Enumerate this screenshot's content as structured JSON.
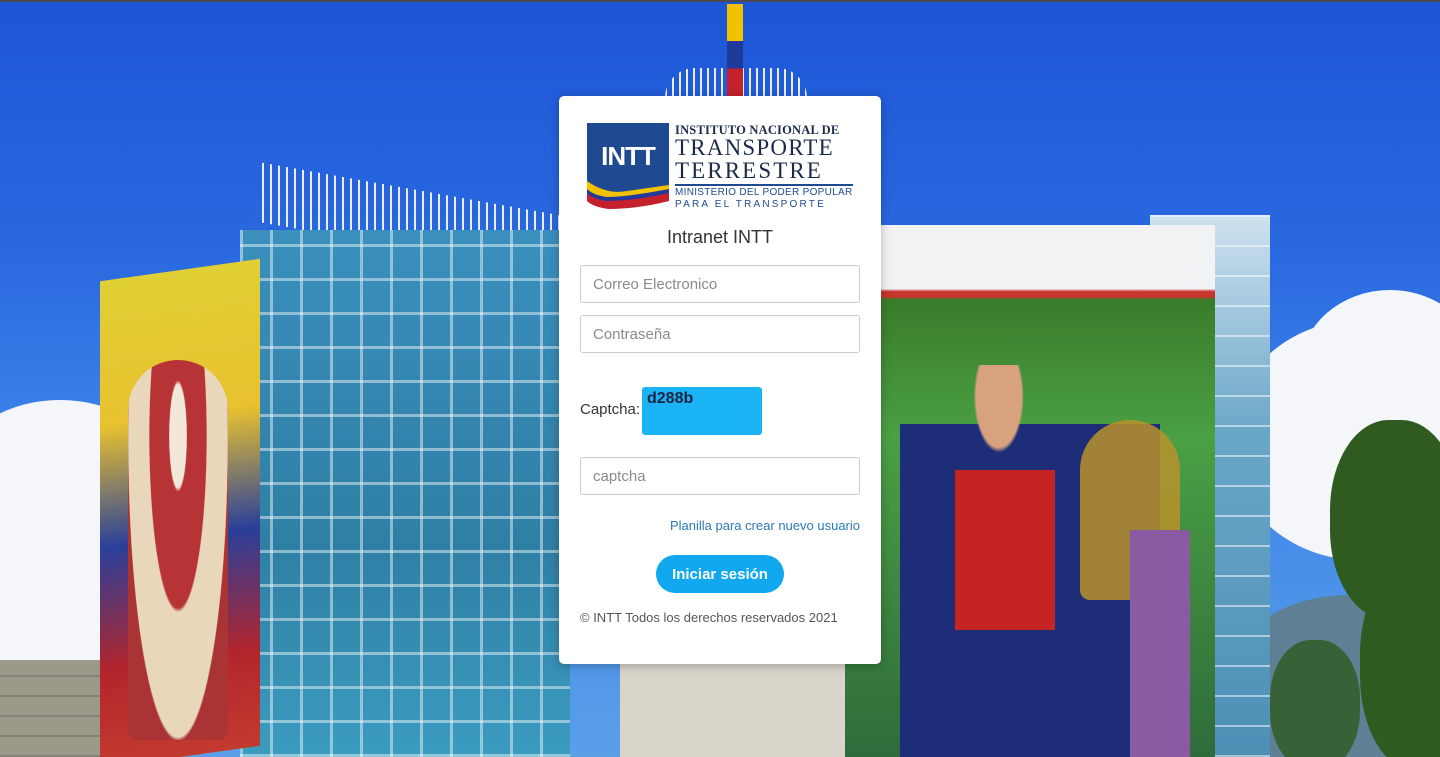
{
  "logo": {
    "abbr": "INTT",
    "line1": "INSTITUTO NACIONAL DE",
    "line2": "TRANSPORTE",
    "line3": "TERRESTRE",
    "line4": "MINISTERIO DEL PODER POPULAR",
    "line5": "PARA EL TRANSPORTE"
  },
  "form": {
    "title": "Intranet INTT",
    "email_placeholder": "Correo Electronico",
    "password_placeholder": "Contraseña",
    "captcha_label": "Captcha:",
    "captcha_code": "d288b",
    "captcha_placeholder": "captcha",
    "register_link": "Planilla para crear nuevo usuario",
    "submit_label": "Iniciar sesión",
    "footer": "© INTT Todos los derechos reservados 2021"
  },
  "colors": {
    "button": "#12a8f0",
    "captcha_bg": "#1ab3f5",
    "link": "#2a7ab8",
    "logo_blue": "#1f4a91"
  }
}
